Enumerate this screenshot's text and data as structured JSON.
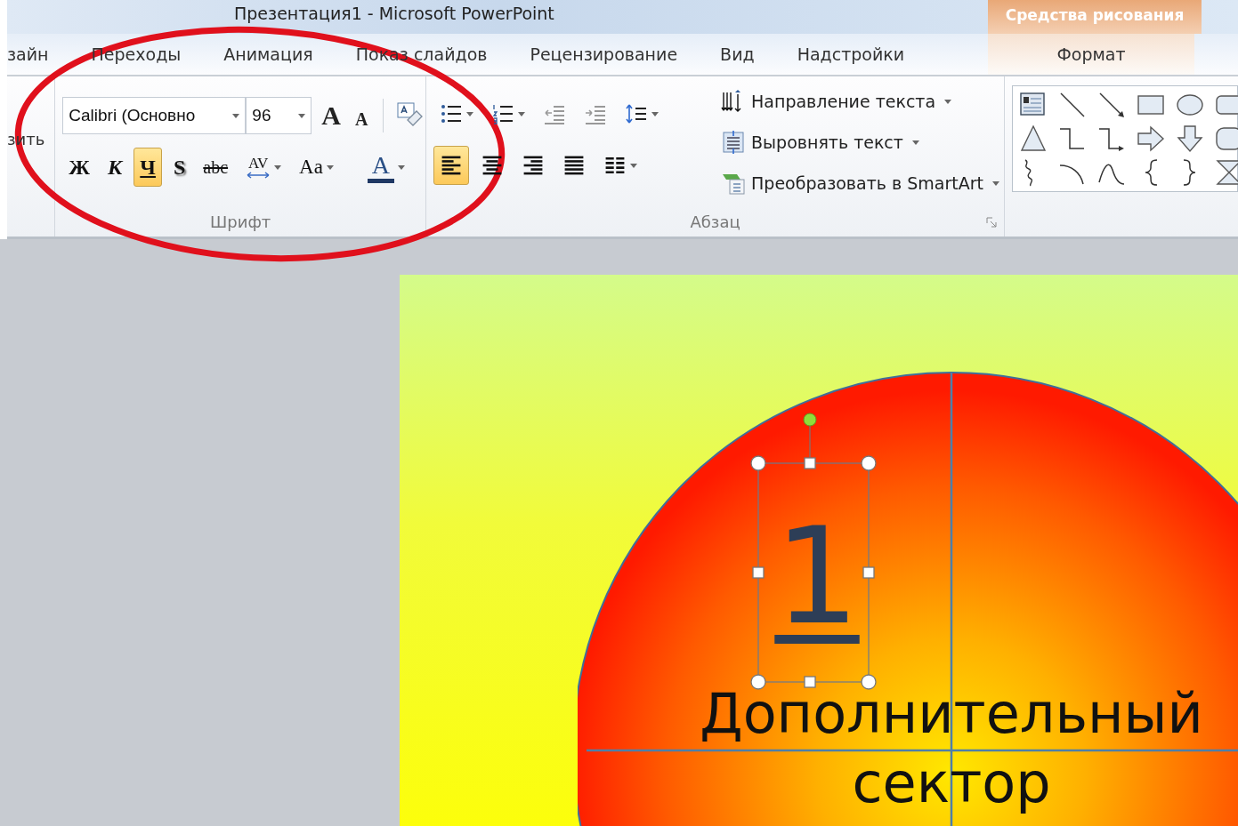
{
  "window": {
    "title": "Презентация1 - Microsoft PowerPoint"
  },
  "ribbon_tabs": [
    {
      "label": "зайн",
      "selected": false
    },
    {
      "label": "Переходы",
      "selected": false
    },
    {
      "label": "Анимация",
      "selected": false
    },
    {
      "label": "Показ слайдов",
      "selected": false
    },
    {
      "label": "Рецензирование",
      "selected": false
    },
    {
      "label": "Вид",
      "selected": false
    },
    {
      "label": "Надстройки",
      "selected": false
    }
  ],
  "contextual_tab": {
    "group": "Средства рисования",
    "label": "Формат",
    "selected": false
  },
  "clipboard_group": {
    "label_fragment": "зить"
  },
  "font_group": {
    "font_name": "Calibri (Основно",
    "font_size": "96",
    "size_buttons": [
      {
        "label": "A",
        "kind": "grow"
      },
      {
        "label": "A",
        "kind": "shrink"
      }
    ],
    "format_buttons": [
      {
        "label": "Ж",
        "kind": "bold",
        "pressed": false
      },
      {
        "label": "К",
        "kind": "italic",
        "pressed": false
      },
      {
        "label": "Ч",
        "kind": "underline",
        "pressed": true
      },
      {
        "label": "S",
        "kind": "shadow",
        "pressed": false
      },
      {
        "label": "abc",
        "kind": "strike",
        "pressed": false
      },
      {
        "label": "AV",
        "kind": "spacing",
        "pressed": false
      },
      {
        "label": "Aa",
        "kind": "case",
        "pressed": false
      },
      {
        "label": "A",
        "kind": "color",
        "pressed": false
      }
    ],
    "label": "Шрифт"
  },
  "paragraph_group": {
    "top_buttons": [
      {
        "kind": "bullets",
        "pressed": false
      },
      {
        "kind": "numbering",
        "pressed": false
      },
      {
        "kind": "outdent",
        "pressed": false
      },
      {
        "kind": "indent",
        "pressed": false
      },
      {
        "kind": "spacing",
        "pressed": false
      }
    ],
    "bottom_buttons": [
      {
        "kind": "left",
        "pressed": true
      },
      {
        "kind": "center",
        "pressed": false
      },
      {
        "kind": "right",
        "pressed": false
      },
      {
        "kind": "justify",
        "pressed": false
      },
      {
        "kind": "columns",
        "pressed": false
      }
    ],
    "commands": [
      {
        "label": "Направление текста",
        "kind": "direction"
      },
      {
        "label": "Выровнять текст",
        "kind": "align"
      },
      {
        "label": "Преобразовать в SmartArt",
        "kind": "smartart"
      }
    ],
    "label": "Абзац"
  },
  "slide": {
    "number_text": "1",
    "caption_lines": [
      "Дополнительный",
      "сектор"
    ]
  }
}
